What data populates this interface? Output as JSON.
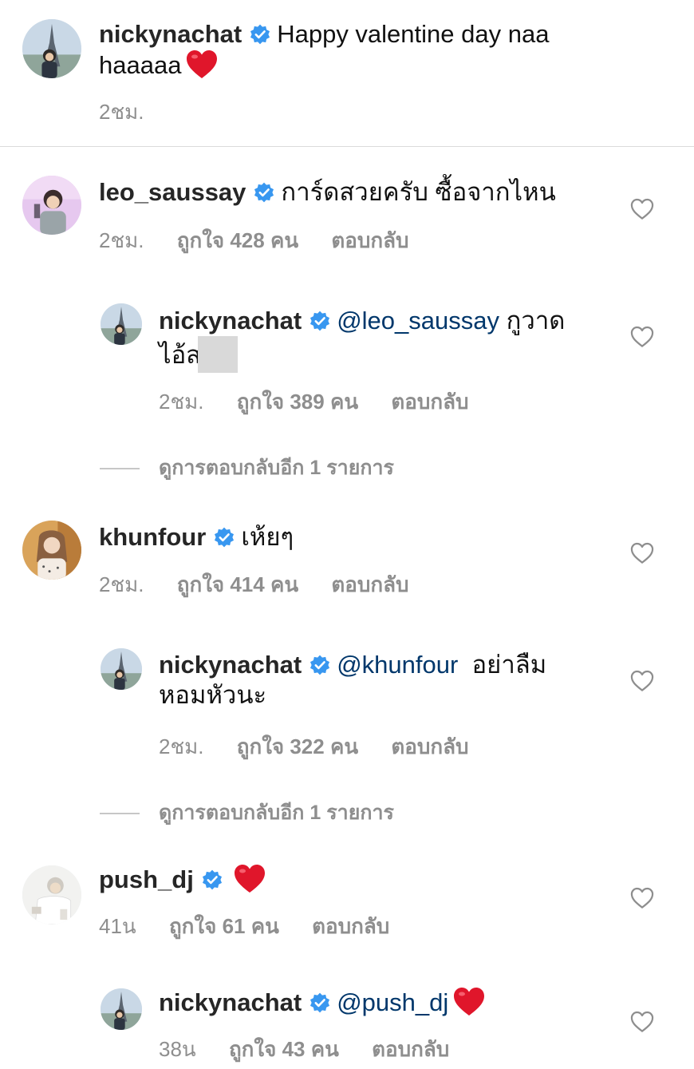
{
  "caption": {
    "username": "nickynachat",
    "text": "Happy valentine day naa haaaaa",
    "time": "2ชม."
  },
  "comments": [
    {
      "username": "leo_saussay",
      "text": "การ์ดสวยครับ ซื้อจากไหน",
      "time": "2ชม.",
      "likes": "ถูกใจ 428 คน",
      "reply_label": "ตอบกลับ",
      "replies": [
        {
          "username": "nickynachat",
          "mention": "@leo_saussay",
          "text": "กูวาดไอ้ส",
          "time": "2ชม.",
          "likes": "ถูกใจ 389 คน",
          "reply_label": "ตอบกลับ"
        }
      ],
      "more_replies": "ดูการตอบกลับอีก 1 รายการ"
    },
    {
      "username": "khunfour",
      "text": "เห้ยๆ",
      "time": "2ชม.",
      "likes": "ถูกใจ 414 คน",
      "reply_label": "ตอบกลับ",
      "replies": [
        {
          "username": "nickynachat",
          "mention": "@khunfour",
          "text": "อย่าลืมหอมหัวนะ",
          "time": "2ชม.",
          "likes": "ถูกใจ 322 คน",
          "reply_label": "ตอบกลับ"
        }
      ],
      "more_replies": "ดูการตอบกลับอีก 1 รายการ"
    },
    {
      "username": "push_dj",
      "text": "",
      "time": "41น",
      "likes": "ถูกใจ 61 คน",
      "reply_label": "ตอบกลับ",
      "replies": [
        {
          "username": "nickynachat",
          "mention": "@push_dj",
          "text": "",
          "time": "38น",
          "likes": "ถูกใจ 43 คน",
          "reply_label": "ตอบกลับ"
        }
      ]
    }
  ],
  "colors": {
    "verified": "#3897f0",
    "heart_emoji": "#e0162b",
    "mention": "#00376b",
    "meta": "#8e8e8e"
  },
  "icons": {
    "verified": "verified-badge-icon",
    "like": "heart-outline-icon",
    "emoji": "red-heart-emoji"
  }
}
